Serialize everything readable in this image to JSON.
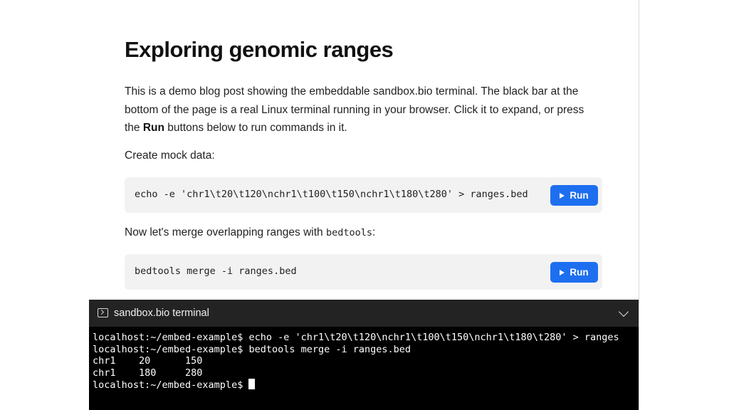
{
  "article": {
    "title": "Exploring genomic ranges",
    "intro_before_bold": "This is a demo blog post showing the embeddable sandbox.bio terminal. The black bar at the bottom of the page is a real Linux terminal running in your browser. Click it to expand, or press the ",
    "intro_bold": "Run",
    "intro_after_bold": " buttons below to run commands in it.",
    "step1_label": "Create mock data:",
    "step1_code": "echo -e 'chr1\\t20\\t120\\nchr1\\t100\\t150\\nchr1\\t180\\t280' > ranges.bed",
    "step2_label_before": "Now let's merge overlapping ranges with ",
    "step2_label_code": "bedtools",
    "step2_label_after": ":",
    "step2_code": "bedtools merge -i ranges.bed",
    "run_label": "Run",
    "run_icon": "play-icon"
  },
  "terminal": {
    "title": "sandbox.bio terminal",
    "header_icon": "terminal-icon",
    "toggle_icon": "chevron-down-icon",
    "lines": [
      "localhost:~/embed-example$ echo -e 'chr1\\t20\\t120\\nchr1\\t100\\t150\\nchr1\\t180\\t280' > ranges",
      "localhost:~/embed-example$ bedtools merge -i ranges.bed",
      "chr1    20      150",
      "chr1    180     280"
    ],
    "prompt": "localhost:~/embed-example$ "
  },
  "colors": {
    "run_button": "#1e6ff0",
    "code_background": "#f2f2f2",
    "terminal_header": "#232323",
    "terminal_background": "#000000"
  }
}
